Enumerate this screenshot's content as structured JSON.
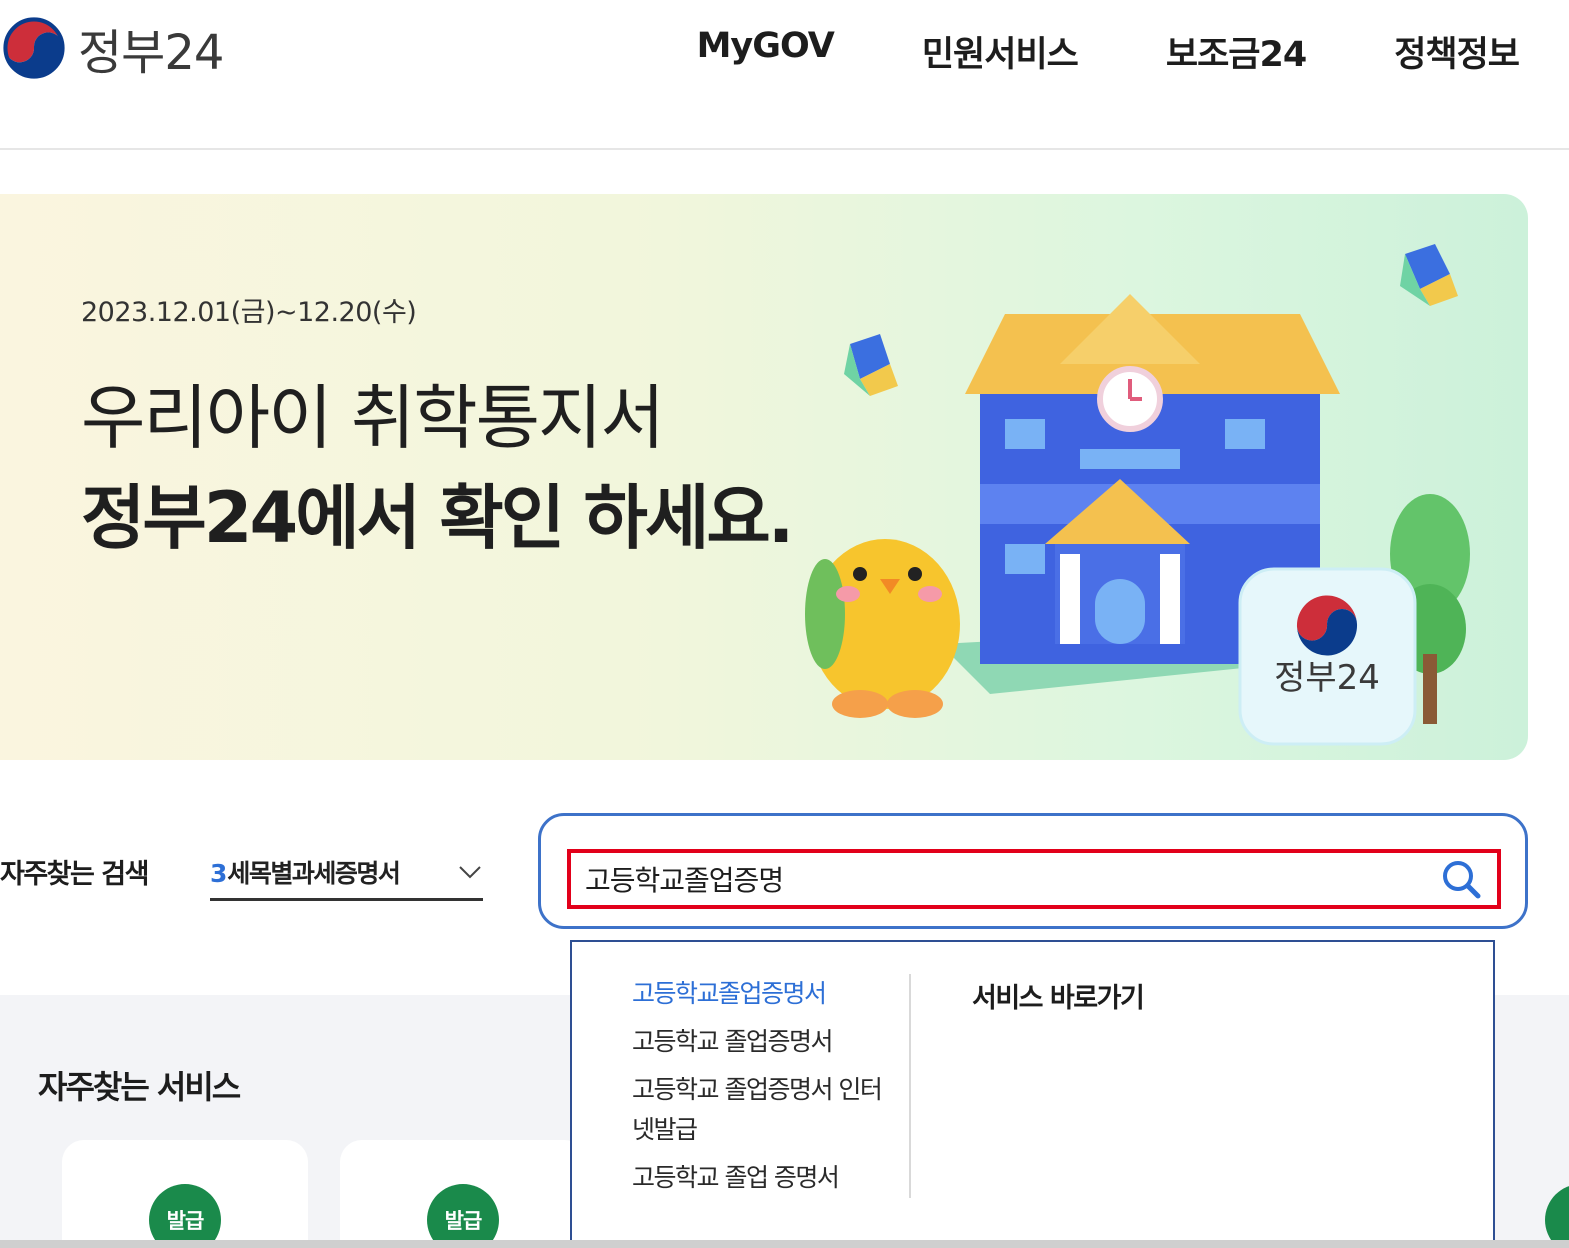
{
  "header": {
    "logo_text": "정부24",
    "nav": [
      "MyGOV",
      "민원서비스",
      "보조금24",
      "정책정보"
    ]
  },
  "banner": {
    "date": "2023.12.01(금)~12.20(수)",
    "title_line1": "우리아이 취학통지서",
    "title_line2": "정부24에서 확인 하세요.",
    "app_badge_text": "정부24"
  },
  "search": {
    "frequent_label": "자주찾는 검색",
    "frequent_rank": "3",
    "frequent_keyword": "세목별과세증명서",
    "query": "고등학교졸업증명"
  },
  "autocomplete": {
    "suggestions": [
      "고등학교졸업증명서",
      "고등학교 졸업증명서",
      "고등학교 졸업증명서 인터넷발급",
      "고등학교 졸업 증명서"
    ],
    "right_title": "서비스 바로가기"
  },
  "services": {
    "title": "자주찾는 서비스",
    "cards": [
      {
        "badge": "발급"
      },
      {
        "badge": "발급"
      }
    ]
  },
  "colors": {
    "accent": "#2d6fd6",
    "search_border": "#3d72c9",
    "highlight_border": "#e2001a",
    "badge_green": "#1a8a4b"
  }
}
